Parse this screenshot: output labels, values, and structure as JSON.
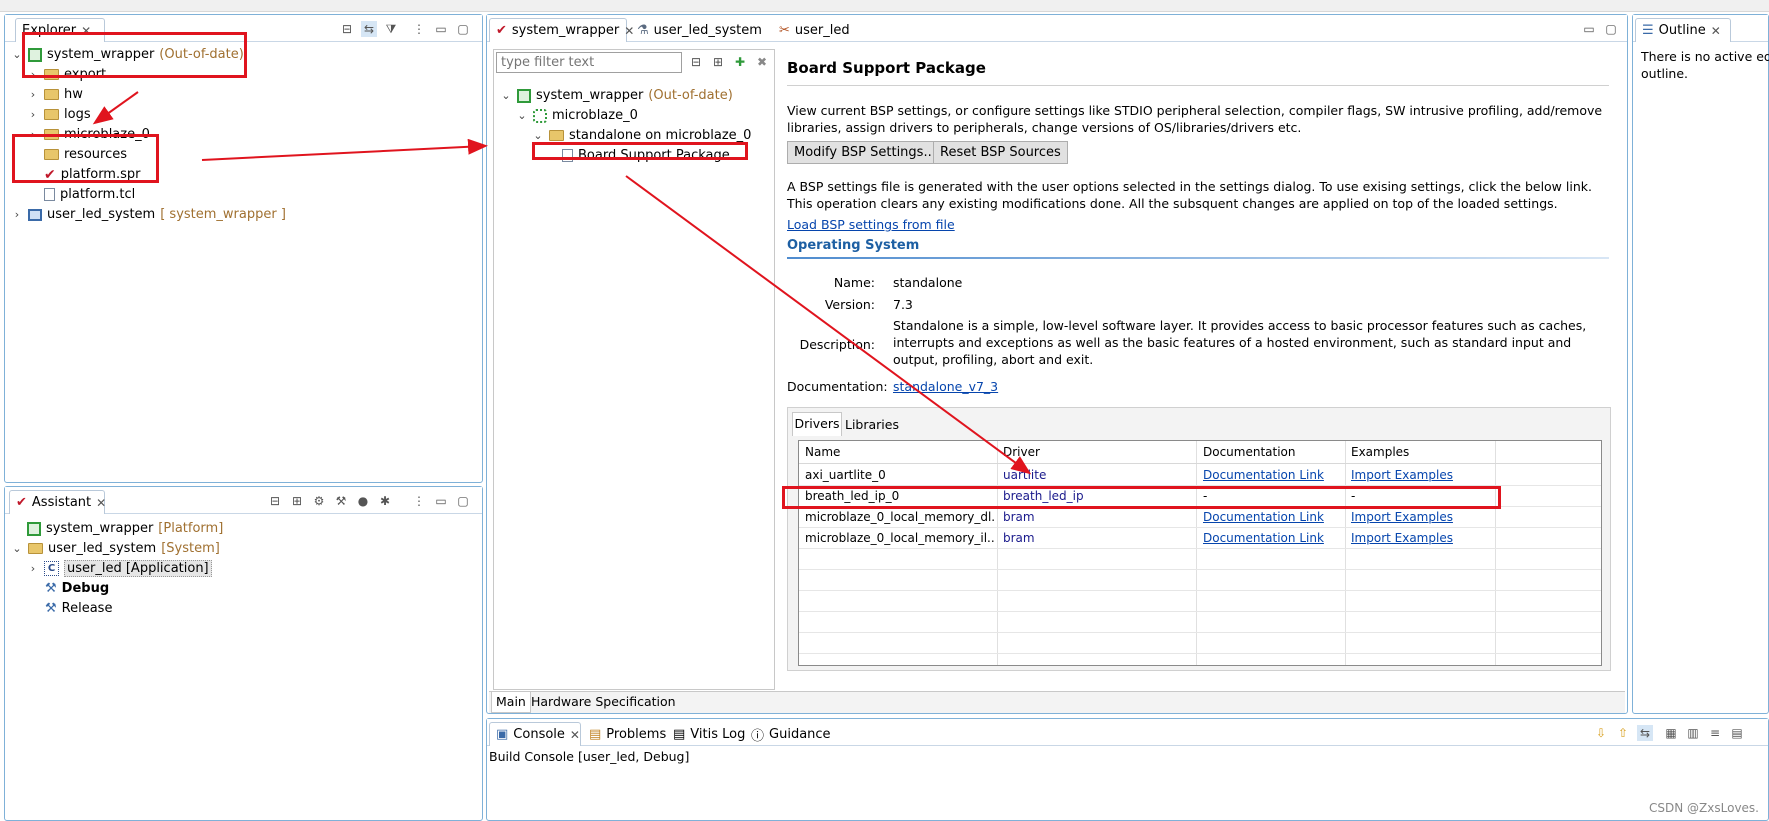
{
  "explorer": {
    "title": "Explorer",
    "items": [
      {
        "label": "system_wrapper",
        "suffix": "(Out-of-date)"
      },
      {
        "label": "export"
      },
      {
        "label": "hw"
      },
      {
        "label": "logs"
      },
      {
        "label": "microblaze_0"
      },
      {
        "label": "resources"
      },
      {
        "label": "platform.spr"
      },
      {
        "label": "platform.tcl"
      },
      {
        "label": "user_led_system",
        "suffix": "[ system_wrapper ]"
      }
    ]
  },
  "assistant": {
    "title": "Assistant",
    "items": [
      {
        "label": "system_wrapper",
        "suffix": "[Platform]"
      },
      {
        "label": "user_led_system",
        "suffix": "[System]"
      },
      {
        "label": "user_led [Application]"
      },
      {
        "label": "Debug"
      },
      {
        "label": "Release"
      }
    ]
  },
  "editor": {
    "tabs": [
      "system_wrapper",
      "user_led_system",
      "user_led"
    ],
    "filter_placeholder": "type filter text",
    "tree": [
      {
        "label": "system_wrapper",
        "suffix": "(Out-of-date)"
      },
      {
        "label": "microblaze_0"
      },
      {
        "label": "standalone on microblaze_0"
      },
      {
        "label": "Board Support Package"
      }
    ],
    "bottom_tabs": [
      "Main",
      "Hardware Specification"
    ]
  },
  "bsp": {
    "title": "Board Support Package",
    "desc": "View current BSP settings, or configure settings like STDIO peripheral selection, compiler flags, SW intrusive profiling, add/remove libraries, assign drivers to peripherals, change versions of OS/libraries/drivers etc.",
    "modify_btn": "Modify BSP Settings...",
    "reset_btn": "Reset BSP Sources",
    "note": "A BSP settings file is generated with the user options selected in the settings dialog. To use exising settings, click the below link. This operation clears any existing modifications done. All the subsquent changes are applied on top of the loaded settings.",
    "load_link": "Load BSP settings from file",
    "os_section": "Operating System",
    "name_label": "Name:",
    "name_value": "standalone",
    "version_label": "Version:",
    "version_value": "7.3",
    "desc_label": "Description:",
    "desc_value": "Standalone is a simple, low-level software layer. It provides access to basic processor features such as caches, interrupts and exceptions as well as the basic features of a hosted environment, such as standard input and output, profiling, abort and exit.",
    "doc_label": "Documentation:",
    "doc_link": "standalone_v7_3",
    "tabs": [
      "Drivers",
      "Libraries"
    ],
    "columns": [
      "Name",
      "Driver",
      "Documentation",
      "Examples"
    ],
    "rows": [
      {
        "name": "axi_uartlite_0",
        "driver": "uartlite",
        "doc": "Documentation Link",
        "ex": "Import Examples"
      },
      {
        "name": "breath_led_ip_0",
        "driver": "breath_led_ip",
        "doc": "-",
        "ex": "-"
      },
      {
        "name": "microblaze_0_local_memory_dl...",
        "driver": "bram",
        "doc": "Documentation Link",
        "ex": "Import Examples"
      },
      {
        "name": "microblaze_0_local_memory_il...",
        "driver": "bram",
        "doc": "Documentation Link",
        "ex": "Import Examples"
      }
    ]
  },
  "outline": {
    "title": "Outline",
    "text1": "There is no active edit",
    "text2": "outline."
  },
  "console": {
    "tabs": [
      "Console",
      "Problems",
      "Vitis Log",
      "Guidance"
    ],
    "text": "Build Console [user_led, Debug]"
  },
  "watermark": "CSDN @ZxsLoves."
}
